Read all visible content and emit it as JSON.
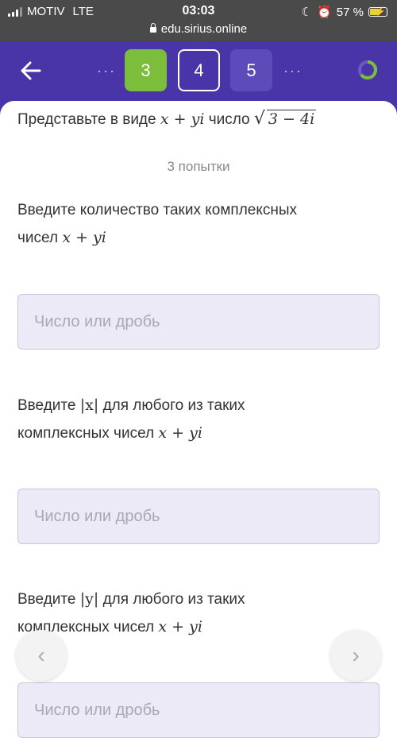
{
  "status": {
    "carrier": "MOTIV",
    "network": "LTE",
    "time": "03:03",
    "battery": "57 %",
    "url": "edu.sirius.online"
  },
  "header": {
    "dots_left": "···",
    "tiles": [
      "3",
      "4",
      "5"
    ],
    "dots_right": "···",
    "colors": {
      "bg": "#4a35a8",
      "done": "#7cbd3b"
    }
  },
  "problem": {
    "prefix": "Представьте в виде",
    "expr": "x + yi",
    "word": "число",
    "radicand": "3 − 4i",
    "attempts": "3 попытки"
  },
  "questions": [
    {
      "line1": "Введите количество таких комплексных",
      "line2_text": "чисел",
      "line2_math": "x + yi",
      "placeholder": "Число или дробь"
    },
    {
      "pre": "Введите",
      "abs": "|x|",
      "post": "для любого из таких",
      "line2_text": "комплексных чисел",
      "line2_math": "x + yi",
      "placeholder": "Число или дробь"
    },
    {
      "pre": "Введите",
      "abs": "|y|",
      "post": "для любого из таких",
      "line2_text": "комплексных чисел",
      "line2_math": "x + yi",
      "placeholder": "Число или дробь"
    }
  ],
  "nav": {
    "prev": "‹",
    "next": "›"
  }
}
